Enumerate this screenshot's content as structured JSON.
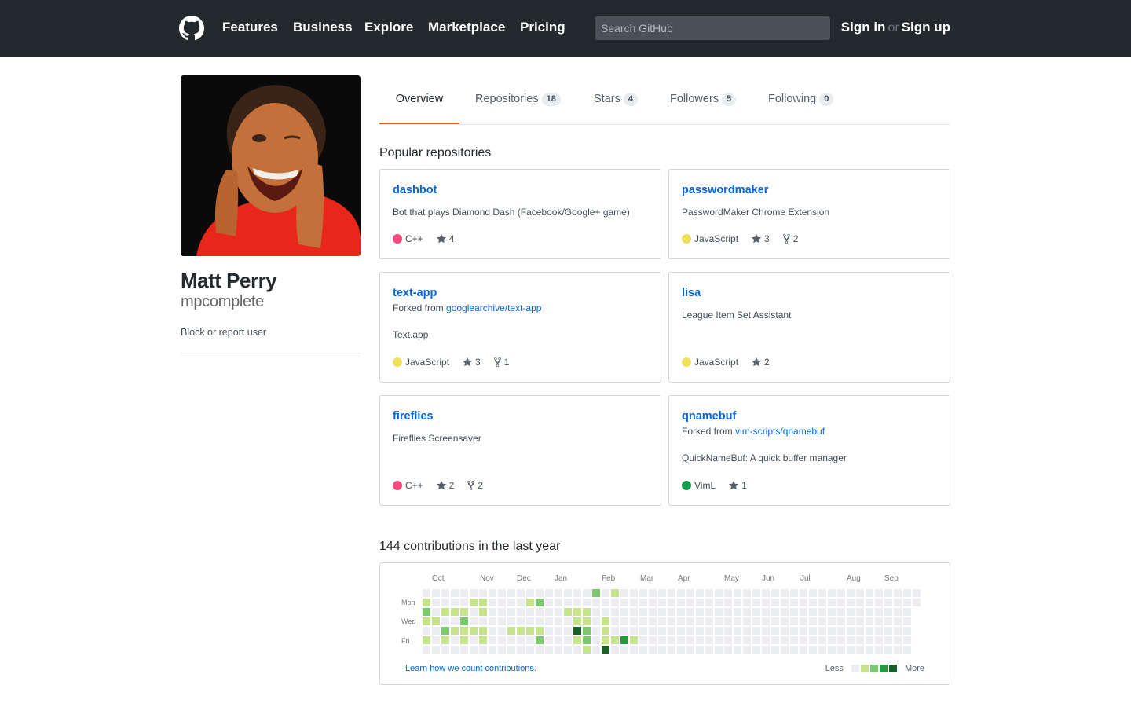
{
  "header": {
    "nav": [
      "Features",
      "Business",
      "Explore",
      "Marketplace",
      "Pricing"
    ],
    "search_placeholder": "Search GitHub",
    "sign_in": "Sign in",
    "or": "or",
    "sign_up": "Sign up"
  },
  "profile": {
    "full_name": "Matt Perry",
    "username": "mpcomplete",
    "block_link": "Block or report user"
  },
  "tabs": [
    {
      "label": "Overview",
      "count": "",
      "active": true
    },
    {
      "label": "Repositories",
      "count": "18",
      "active": false
    },
    {
      "label": "Stars",
      "count": "4",
      "active": false
    },
    {
      "label": "Followers",
      "count": "5",
      "active": false
    },
    {
      "label": "Following",
      "count": "0",
      "active": false
    }
  ],
  "popular": {
    "title": "Popular repositories",
    "repos": [
      {
        "name": "dashbot",
        "fork_prefix": "",
        "fork_source": "",
        "description": "Bot that plays Diamond Dash (Facebook/Google+ game)",
        "language": "C++",
        "lang_color": "#f34b7d",
        "stars": "4",
        "forks": ""
      },
      {
        "name": "passwordmaker",
        "fork_prefix": "",
        "fork_source": "",
        "description": "PasswordMaker Chrome Extension",
        "language": "JavaScript",
        "lang_color": "#f1e05a",
        "stars": "3",
        "forks": "2"
      },
      {
        "name": "text-app",
        "fork_prefix": "Forked from",
        "fork_source": "googlearchive/text-app",
        "description": "Text.app",
        "language": "JavaScript",
        "lang_color": "#f1e05a",
        "stars": "3",
        "forks": "1"
      },
      {
        "name": "lisa",
        "fork_prefix": "",
        "fork_source": "",
        "description": "League Item Set Assistant",
        "language": "JavaScript",
        "lang_color": "#f1e05a",
        "stars": "2",
        "forks": ""
      },
      {
        "name": "fireflies",
        "fork_prefix": "",
        "fork_source": "",
        "description": "Fireflies Screensaver",
        "language": "C++",
        "lang_color": "#f34b7d",
        "stars": "2",
        "forks": "2"
      },
      {
        "name": "qnamebuf",
        "fork_prefix": "Forked from",
        "fork_source": "vim-scripts/qnamebuf",
        "description": "QuickNameBuf: A quick buffer manager",
        "language": "VimL",
        "lang_color": "#199f4b",
        "stars": "1",
        "forks": ""
      }
    ]
  },
  "contributions": {
    "title": "144 contributions in the last year",
    "months": [
      "Oct",
      "Nov",
      "Dec",
      "Jan",
      "Feb",
      "Mar",
      "Apr",
      "May",
      "Jun",
      "Jul",
      "Aug",
      "Sep"
    ],
    "days": [
      "Mon",
      "Wed",
      "Fri"
    ],
    "learn_link": "Learn how we count contributions.",
    "legend_less": "Less",
    "legend_more": "More",
    "colors": [
      "#ebedf0",
      "#c6e48b",
      "#7bc96f",
      "#239a3b",
      "#196127"
    ],
    "active_cells": [
      [
        0,
        1,
        1
      ],
      [
        0,
        2,
        2
      ],
      [
        0,
        3,
        1
      ],
      [
        0,
        5,
        1
      ],
      [
        1,
        3,
        1
      ],
      [
        2,
        2,
        1
      ],
      [
        2,
        4,
        2
      ],
      [
        2,
        5,
        1
      ],
      [
        3,
        2,
        1
      ],
      [
        3,
        4,
        1
      ],
      [
        4,
        2,
        1
      ],
      [
        4,
        3,
        2
      ],
      [
        4,
        4,
        1
      ],
      [
        4,
        5,
        1
      ],
      [
        5,
        1,
        1
      ],
      [
        5,
        4,
        1
      ],
      [
        6,
        1,
        1
      ],
      [
        6,
        2,
        1
      ],
      [
        6,
        4,
        1
      ],
      [
        6,
        5,
        1
      ],
      [
        9,
        4,
        1
      ],
      [
        10,
        4,
        1
      ],
      [
        11,
        1,
        1
      ],
      [
        11,
        4,
        1
      ],
      [
        12,
        1,
        2
      ],
      [
        12,
        4,
        1
      ],
      [
        12,
        5,
        2
      ],
      [
        15,
        2,
        1
      ],
      [
        16,
        2,
        1
      ],
      [
        16,
        3,
        1
      ],
      [
        16,
        4,
        4
      ],
      [
        16,
        5,
        1
      ],
      [
        17,
        2,
        1
      ],
      [
        17,
        3,
        1
      ],
      [
        17,
        4,
        2
      ],
      [
        17,
        5,
        2
      ],
      [
        17,
        6,
        1
      ],
      [
        18,
        0,
        2
      ],
      [
        19,
        3,
        1
      ],
      [
        19,
        4,
        1
      ],
      [
        19,
        5,
        1
      ],
      [
        19,
        6,
        4
      ],
      [
        20,
        0,
        1
      ],
      [
        20,
        5,
        1
      ],
      [
        21,
        5,
        3
      ],
      [
        22,
        5,
        1
      ]
    ]
  }
}
